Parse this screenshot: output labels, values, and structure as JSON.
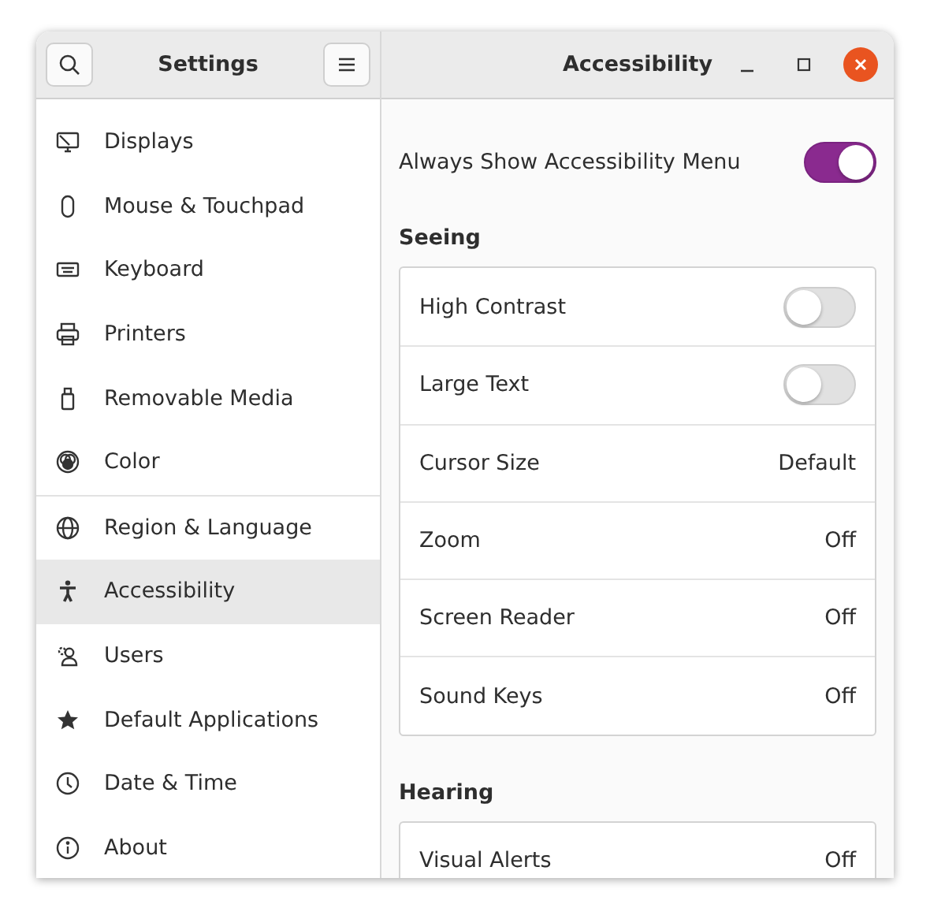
{
  "sidebar": {
    "title": "Settings",
    "items": [
      {
        "label": "Displays",
        "selected": false
      },
      {
        "label": "Mouse & Touchpad",
        "selected": false
      },
      {
        "label": "Keyboard",
        "selected": false
      },
      {
        "label": "Printers",
        "selected": false
      },
      {
        "label": "Removable Media",
        "selected": false
      },
      {
        "label": "Color",
        "selected": false
      },
      {
        "label": "Region & Language",
        "selected": false
      },
      {
        "label": "Accessibility",
        "selected": true
      },
      {
        "label": "Users",
        "selected": false
      },
      {
        "label": "Default Applications",
        "selected": false
      },
      {
        "label": "Date & Time",
        "selected": false
      },
      {
        "label": "About",
        "selected": false
      }
    ]
  },
  "window": {
    "title": "Accessibility"
  },
  "top_setting": {
    "label": "Always Show Accessibility Menu",
    "on": true
  },
  "sections": [
    {
      "title": "Seeing",
      "rows": [
        {
          "kind": "switch",
          "label": "High Contrast",
          "on": false
        },
        {
          "kind": "switch",
          "label": "Large Text",
          "on": false
        },
        {
          "kind": "value",
          "label": "Cursor Size",
          "value": "Default"
        },
        {
          "kind": "value",
          "label": "Zoom",
          "value": "Off"
        },
        {
          "kind": "value",
          "label": "Screen Reader",
          "value": "Off"
        },
        {
          "kind": "value",
          "label": "Sound Keys",
          "value": "Off"
        }
      ]
    },
    {
      "title": "Hearing",
      "rows": [
        {
          "kind": "value",
          "label": "Visual Alerts",
          "value": "Off"
        }
      ]
    }
  ]
}
